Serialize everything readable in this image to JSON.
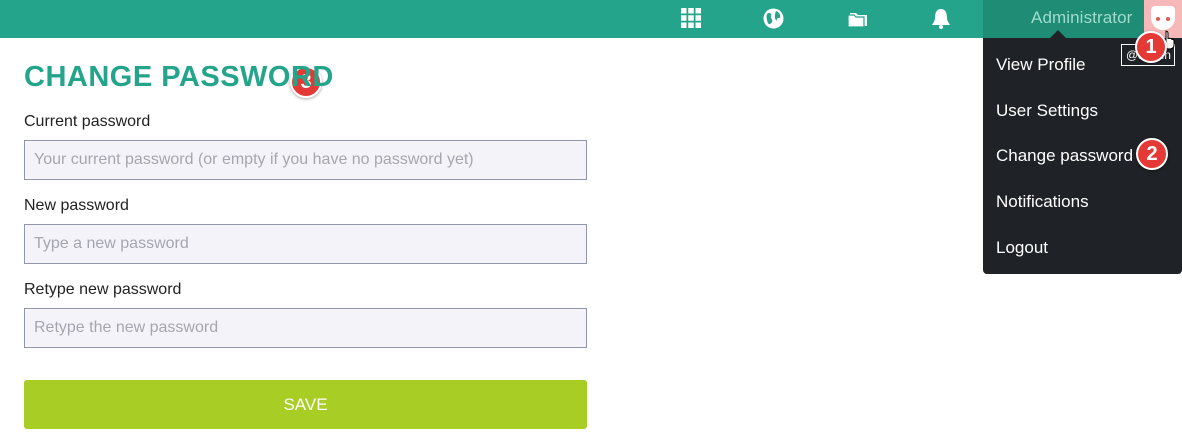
{
  "topbar": {
    "icons": [
      "apps-grid-icon",
      "globe-icon",
      "folder-icon",
      "bell-icon"
    ],
    "user_name": "Administrator",
    "tooltip": "@admin",
    "colors": {
      "bar": "#24a48a",
      "user_area": "#1f8c76",
      "menu_bg": "#1f2226"
    }
  },
  "user_menu": {
    "items": [
      {
        "label": "View Profile"
      },
      {
        "label": "User Settings"
      },
      {
        "label": "Change password"
      },
      {
        "label": "Notifications"
      },
      {
        "label": "Logout"
      }
    ]
  },
  "annotations": [
    "1",
    "2",
    "3"
  ],
  "form": {
    "title": "CHANGE PASSWORD",
    "fields": [
      {
        "label": "Current password",
        "placeholder": "Your current password (or empty if you have no password yet)"
      },
      {
        "label": "New password",
        "placeholder": "Type a new password"
      },
      {
        "label": "Retype new password",
        "placeholder": "Retype the new password"
      }
    ],
    "save_label": "SAVE",
    "colors": {
      "title": "#24a48a",
      "save": "#a8cd24"
    }
  }
}
